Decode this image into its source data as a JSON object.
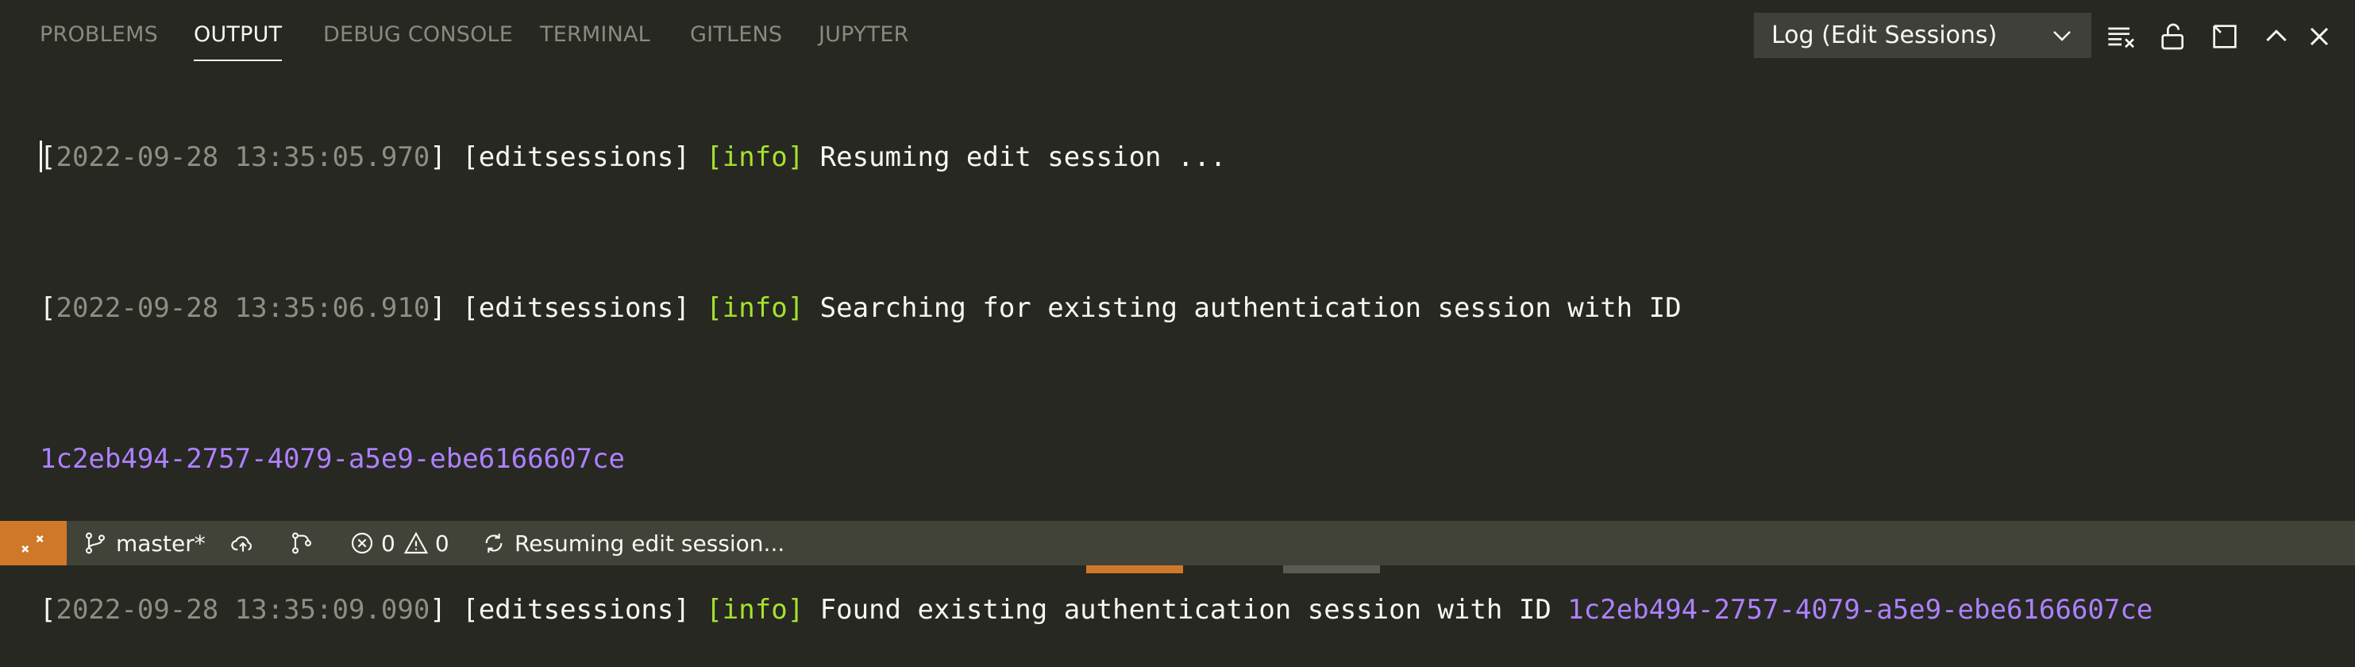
{
  "panel": {
    "tabs": [
      {
        "label": "PROBLEMS",
        "active": false
      },
      {
        "label": "OUTPUT",
        "active": true
      },
      {
        "label": "DEBUG CONSOLE",
        "active": false
      },
      {
        "label": "TERMINAL",
        "active": false
      },
      {
        "label": "GITLENS",
        "active": false
      },
      {
        "label": "JUPYTER",
        "active": false
      }
    ],
    "channel_select": "Log (Edit Sessions)",
    "actions": [
      "clear-output-icon",
      "lock-scroll-icon",
      "open-in-editor-icon",
      "maximize-panel-icon",
      "close-panel-icon"
    ]
  },
  "output": {
    "lines": [
      {
        "ts": "2022-09-28 13:35:05.970",
        "cat": "editsessions",
        "lvl": "info",
        "msg": "Resuming edit session ..."
      },
      {
        "ts": "2022-09-28 13:35:06.910",
        "cat": "editsessions",
        "lvl": "info",
        "msg": "Searching for existing authentication session with ID"
      },
      {
        "uuid": "1c2eb494-2757-4079-a5e9-ebe6166607ce"
      },
      {
        "ts": "2022-09-28 13:35:09.090",
        "cat": "editsessions",
        "lvl": "info",
        "msg": "Found existing authentication session with ID",
        "uuid": "1c2eb494-2757-4079-a5e9-ebe6166607ce"
      }
    ]
  },
  "statusbar": {
    "branch": "master*",
    "errors": "0",
    "warnings": "0",
    "progress": "Resuming edit session..."
  },
  "colors": {
    "background": "#272822",
    "remote_accent": "#d0782a",
    "info_level": "#a6e22e",
    "uuid": "#ae81ff"
  }
}
